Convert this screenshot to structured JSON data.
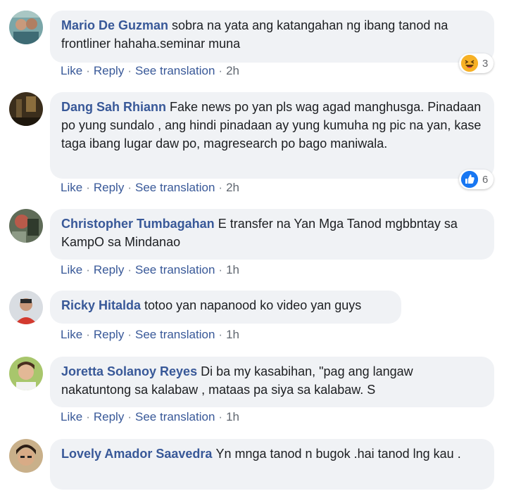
{
  "dot": "·",
  "comments": [
    {
      "author": "Mario De Guzman",
      "text": "sobra na yata ang katangahan ng ibang tanod na frontliner hahaha.seminar muna",
      "like": "Like",
      "reply": "Reply",
      "translate": "See translation",
      "time": "2h",
      "reaction": {
        "type": "haha",
        "count": "3"
      }
    },
    {
      "author": "Dang Sah Rhiann",
      "text": "Fake news po yan pls wag agad manghusga. Pinadaan po yung sundalo , ang hindi pinadaan ay yung kumuha ng pic na yan, kase taga ibang lugar daw po, magresearch po bago maniwala.",
      "like": "Like",
      "reply": "Reply",
      "translate": "See translation",
      "time": "2h",
      "reaction": {
        "type": "like",
        "count": "6"
      }
    },
    {
      "author": "Christopher Tumbagahan",
      "text": "E transfer na Yan Mga Tanod mgbbntay sa KampO sa Mindanao",
      "like": "Like",
      "reply": "Reply",
      "translate": "See translation",
      "time": "1h"
    },
    {
      "author": "Ricky Hitalda",
      "text": "totoo yan napanood ko video yan guys",
      "like": "Like",
      "reply": "Reply",
      "translate": "See translation",
      "time": "1h"
    },
    {
      "author": "Joretta Solanoy Reyes",
      "text": "Di ba my kasabihan, \"pag ang langaw nakatuntong sa kalabaw , mataas pa siya sa kalabaw. S",
      "like": "Like",
      "reply": "Reply",
      "translate": "See translation",
      "time": "1h"
    },
    {
      "author": "Lovely Amador Saavedra",
      "text": "Yn mnga tanod n bugok .hai tanod lng kau .",
      "like": "Like",
      "reply": "Reply",
      "translate": "See translation",
      "time": ""
    }
  ],
  "colors": {
    "link": "#385898",
    "bubble": "#f0f2f5",
    "like": "#1877f2",
    "haha": "#f7b125"
  }
}
